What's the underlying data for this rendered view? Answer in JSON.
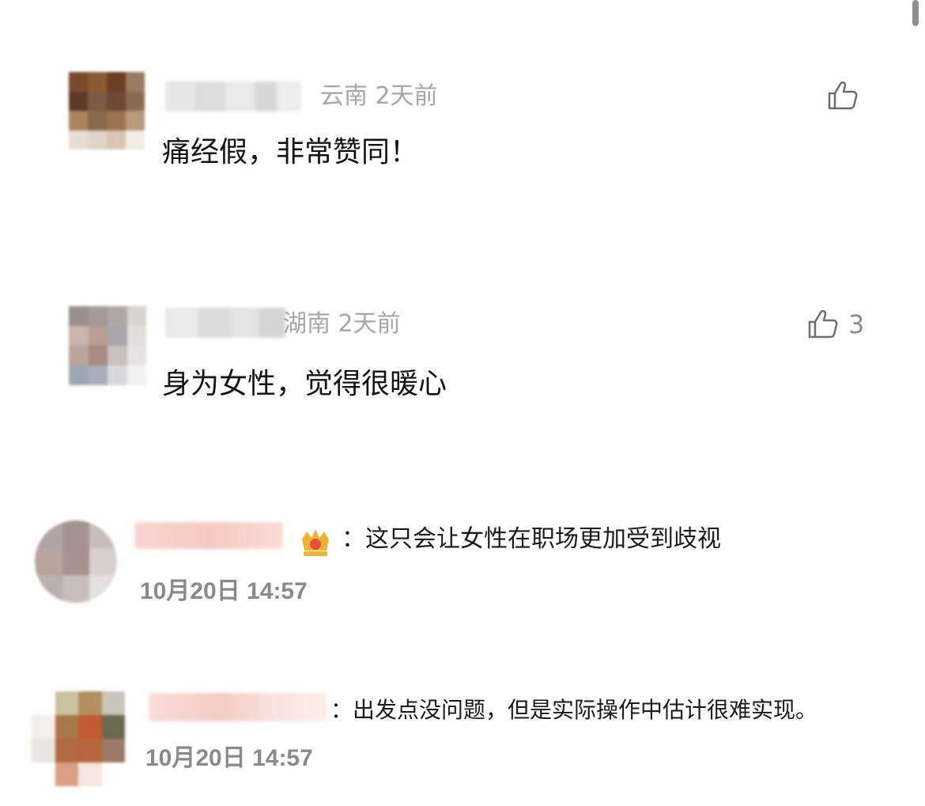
{
  "comments": [
    {
      "region": "云南",
      "time_ago": "2天前",
      "text": "痛经假，非常赞同！",
      "like_count": "",
      "avatar_colors": [
        "#7a4a2e",
        "#8a5a30",
        "#6b3d22",
        "#9a7a60",
        "#5e3a2a",
        "#7d5a45",
        "#6e4a35",
        "#8c6a50",
        "#a9835c",
        "#8a6a4c",
        "#9b7550",
        "#b89a7c",
        "#e8ddd0",
        "#ded4c8",
        "#d9c6b0",
        "#f1ece5"
      ]
    },
    {
      "region": "湖南",
      "time_ago": "2天前",
      "text": "身为女性，觉得很暖心",
      "like_count": "3",
      "avatar_colors": [
        "#9a8f8e",
        "#a59a98",
        "#b0a6a5",
        "#d8d3d2",
        "#c9b3ad",
        "#b99d95",
        "#a8a6a8",
        "#e2dcda",
        "#b8a39d",
        "#a88b82",
        "#c9c0c0",
        "#e6e2e3",
        "#9da6b2",
        "#a8aeb9",
        "#d7d8dc",
        "#f2f0f0"
      ]
    }
  ],
  "replies": [
    {
      "separator": "：",
      "text": "这只会让女性在职场更加受到歧视",
      "time": "10月20日 14:57",
      "badge_icon": "crown-badge-icon",
      "avatar_colors": [
        "#b0a4a2",
        "#a39391",
        "#c6bcbc",
        "#b8a39a",
        "#a99290",
        "#d8cfcf",
        "#bbb0ae",
        "#c7bdbd",
        "#e4dfe0"
      ]
    },
    {
      "separator": "：",
      "text": "出发点没问题，但是实际操作中估计很难实现。",
      "time": "10月20日 14:57",
      "avatar_colors": [
        "#ffffff",
        "#c9c2a0",
        "#b09060",
        "#c8c4b8",
        "#f3eeea",
        "#a8784a",
        "#c05a30",
        "#6a6a50",
        "#e8e4e0",
        "#b06a40",
        "#b8643c",
        "#9a7a68",
        "#ffffff",
        "#d8a080",
        "#f2e6df",
        "#ffffff"
      ]
    }
  ],
  "colors": {
    "like_icon": "#6e6e6e",
    "badge_gold": "#f0b330",
    "badge_red": "#e8503a"
  }
}
